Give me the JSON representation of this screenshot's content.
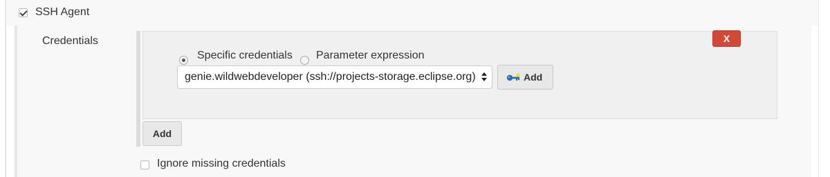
{
  "ssh_agent": {
    "label": "SSH Agent",
    "checked": true
  },
  "credentials": {
    "label": "Credentials",
    "delete_label": "X",
    "radio_specific_label": "Specific credentials",
    "radio_param_label": "Parameter expression",
    "selected_mode": "specific",
    "selected_credential": "genie.wildwebdeveloper (ssh://projects-storage.eclipse.org)",
    "add_credential_label": "Add",
    "add_label": "Add"
  },
  "ignore_missing": {
    "label": "Ignore missing credentials",
    "checked": false
  },
  "colors": {
    "delete_button": "#d24939",
    "panel_background": "#f0f0f0",
    "section_background": "#f8f8f8"
  },
  "icons": {
    "key": "key-icon",
    "select_arrows": "select-arrows-icon"
  }
}
